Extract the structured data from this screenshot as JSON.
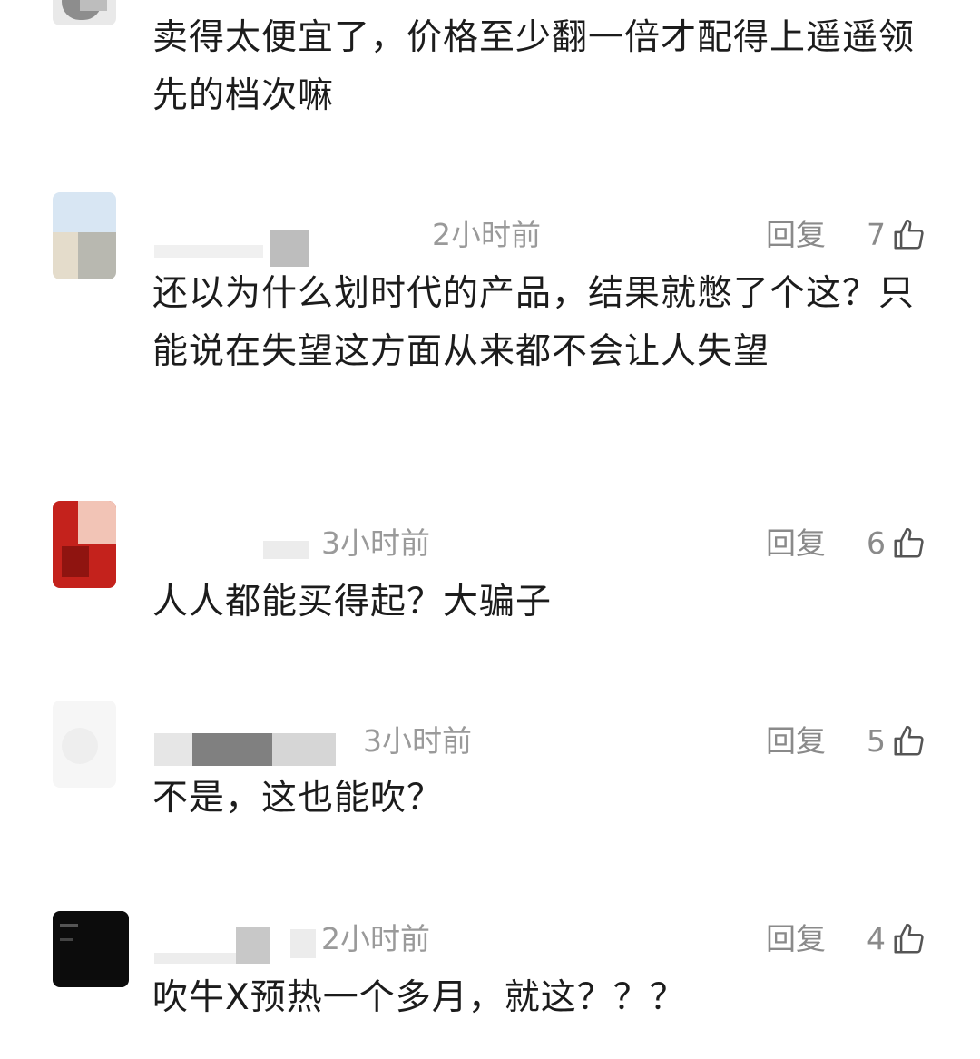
{
  "comments": [
    {
      "text": "卖得太便宜了，价格至少翻一倍才配得上遥遥领先的档次嘛"
    },
    {
      "time": "2小时前",
      "reply_label": "回复",
      "likes": "7",
      "text": "还以为什么划时代的产品，结果就憋了个这？只能说在失望这方面从来都不会让人失望"
    },
    {
      "time": "3小时前",
      "reply_label": "回复",
      "likes": "6",
      "text": "人人都能买得起？大骗子"
    },
    {
      "time": "3小时前",
      "reply_label": "回复",
      "likes": "5",
      "text": "不是，这也能吹？"
    },
    {
      "time": "2小时前",
      "reply_label": "回复",
      "likes": "4",
      "text": "吹牛X预热一个多月，就这？？？"
    }
  ],
  "icons": {
    "like": "thumbs-up-icon"
  },
  "colors": {
    "meta_text": "#8a8a8a",
    "body_text": "#1c1c1c"
  }
}
